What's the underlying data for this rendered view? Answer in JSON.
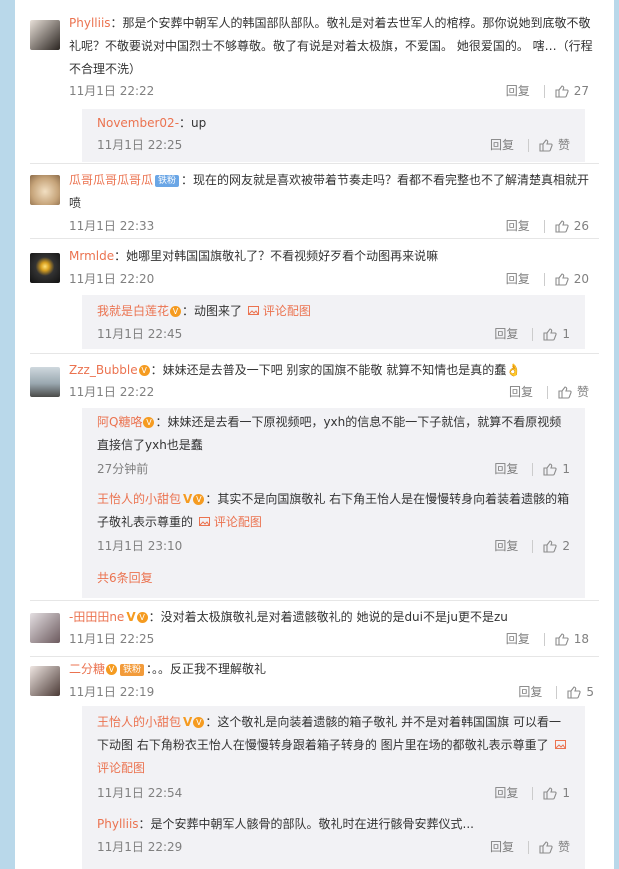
{
  "comments": [
    {
      "user": "Phylliis",
      "text": "：那是个安葬中朝军人的韩国部队部队。敬礼是对着去世军人的棺椁。那你说她到底敬不敬礼呢？不敬要说对中国烈士不够尊敬。敬了有说是对着太极旗，不爱国。 她很爱国的。 嗐…（行程不合理不洗）",
      "time": "11月1日 22:22",
      "reply": "回复",
      "likes": "27"
    },
    {
      "user": "瓜哥瓜哥瓜哥瓜",
      "badge": "铁粉",
      "text": "：现在的网友就是喜欢被带着节奏走吗？看都不看完整也不了解清楚真相就开喷",
      "time": "11月1日 22:33",
      "reply": "回复",
      "likes": "26"
    },
    {
      "user": "Mrmlde",
      "text": "：她哪里对韩国国旗敬礼了？不看视频好歹看个动图再来说嘛",
      "time": "11月1日 22:20",
      "reply": "回复",
      "likes": "20"
    },
    {
      "user": "Zzz_Bubble",
      "text": "：妹妹还是去普及一下吧 别家的国旗不能敬 就算不知情也是真的蠢👌",
      "time": "11月1日 22:22",
      "reply": "回复",
      "likes": "赞"
    },
    {
      "user": "-田田田ne",
      "text": "：没对着太极旗敬礼是对着遗骸敬礼的 她说的是dui不是ju更不是zu",
      "time": "11月1日 22:25",
      "reply": "回复",
      "likes": "18"
    },
    {
      "user": "二分糖",
      "badge": "铁粉",
      "text": "：。。反正我不理解敬礼",
      "time": "11月1日 22:19",
      "reply": "回复",
      "likes": "5"
    }
  ],
  "replies": [
    {
      "user": "November02-",
      "text": "：up",
      "time": "11月1日 22:25",
      "reply": "回复",
      "likes": "赞"
    },
    {
      "user": "我就是白莲花",
      "text": "：动图来了",
      "pic": "评论配图",
      "time": "11月1日 22:45",
      "reply": "回复",
      "likes": "1"
    },
    {
      "user": "阿Q糖咯",
      "text": "：妹妹还是去看一下原视频吧，yxh的信息不能一下子就信，就算不看原视频直接信了yxh也是蠢",
      "time": "27分钟前",
      "reply": "回复",
      "likes": "1"
    },
    {
      "user": "王怡人的小甜包",
      "text": "：其实不是向国旗敬礼 右下角王怡人是在慢慢转身向着装着遗骸的箱子敬礼表示尊重的",
      "pic": "评论配图",
      "time": "11月1日 23:10",
      "reply": "回复",
      "likes": "2"
    },
    {
      "user": "王怡人的小甜包",
      "text": "：这个敬礼是向装着遗骸的箱子敬礼 并不是对着韩国国旗 可以看一下动图 右下角粉衣王怡人在慢慢转身跟着箱子转身的 图片里在场的都敬礼表示尊重了",
      "pic": "评论配图",
      "time": "11月1日 22:54",
      "reply": "回复",
      "likes": "1"
    },
    {
      "user": "Phylliis",
      "text": "：是个安葬中朝军人骸骨的部队。敬礼时在进行骸骨安葬仪式...",
      "time": "11月1日 22:29",
      "reply": "回复",
      "likes": "赞"
    }
  ],
  "more_replies": "共6条回复",
  "icons": {
    "like": "thumbs-up-icon",
    "pic": "image-icon"
  }
}
